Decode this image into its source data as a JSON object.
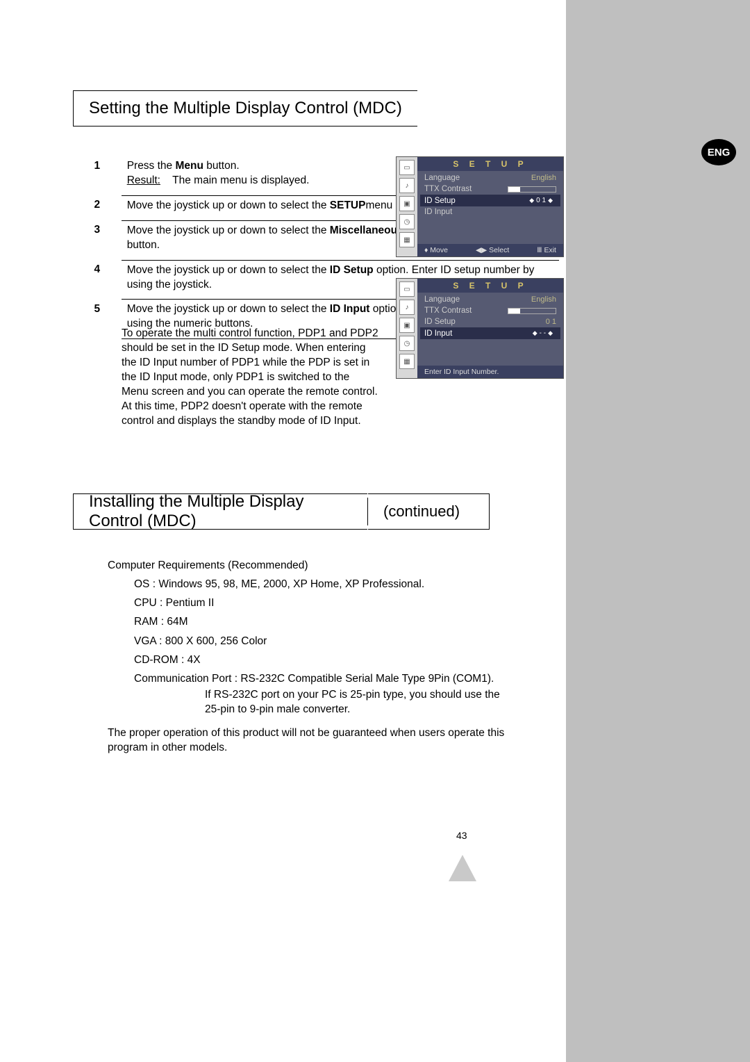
{
  "lang_badge": "ENG",
  "section1": {
    "title": "Setting the Multiple Display Control (MDC)",
    "steps": [
      {
        "num": "1",
        "text_a": "Press the ",
        "bold_a": "Menu",
        "text_b": " button.",
        "result_label": "Result:",
        "result_text": "The main menu is displayed."
      },
      {
        "num": "2",
        "text_a": "Move the joystick up or down to select the ",
        "bold_a": "SETUP",
        "text_b": "menu and press the joystick button."
      },
      {
        "num": "3",
        "text_a": "Move the joystick up or down to select the ",
        "bold_a": "Miscellaneous",
        "text_b": " menu and press the joystick button."
      },
      {
        "num": "4",
        "text_a": "Move the joystick up or down to select the ",
        "bold_a": "ID Setup",
        "text_b": " option. Enter ID setup number by using the joystick."
      },
      {
        "num": "5",
        "text_a": "Move the joystick up or down to select the ",
        "bold_a": "ID Input",
        "text_b": " option. Enter ID setup number by using the numeric buttons."
      }
    ],
    "note": "To operate the multi control function, PDP1 and PDP2 should be set in the ID Setup mode. When entering the ID Input number of PDP1 while the PDP is set in the ID Input mode, only PDP1 is switched to the Menu screen and you can operate the remote control. At this time, PDP2 doesn't operate with the remote control and displays the standby mode of ID Input."
  },
  "section2": {
    "title": "Installing the Multiple Display Control (MDC)",
    "subtitle": "(continued)",
    "req_title": "Computer Requirements (Recommended)",
    "os": "OS : Windows 95, 98, ME, 2000, XP Home, XP Professional.",
    "cpu": "CPU : Pentium II",
    "ram": "RAM : 64M",
    "vga": "VGA : 800 X 600, 256 Color",
    "cdrom": "CD-ROM : 4X",
    "comm": "Communication Port : RS-232C Compatible Serial Male Type 9Pin (COM1).",
    "comm_note1": "If RS-232C port on your PC is 25-pin type, you should use the",
    "comm_note2": "25-pin to 9-pin male converter.",
    "warning": "The proper operation of this product will not be guaranteed when users operate this program in other models."
  },
  "osd": {
    "title": "S E T U P",
    "language_label": "Language",
    "language_val": "English",
    "ttx_label": "TTX Contrast",
    "idsetup_label": "ID Setup",
    "idsetup_val": "0 1",
    "idinput_label": "ID Input",
    "idinput_val": "- -",
    "move": "Move",
    "select": "Select",
    "exit": "Exit",
    "hint2": "Enter ID Input Number.",
    "joy": "◆"
  },
  "page_number": "43"
}
